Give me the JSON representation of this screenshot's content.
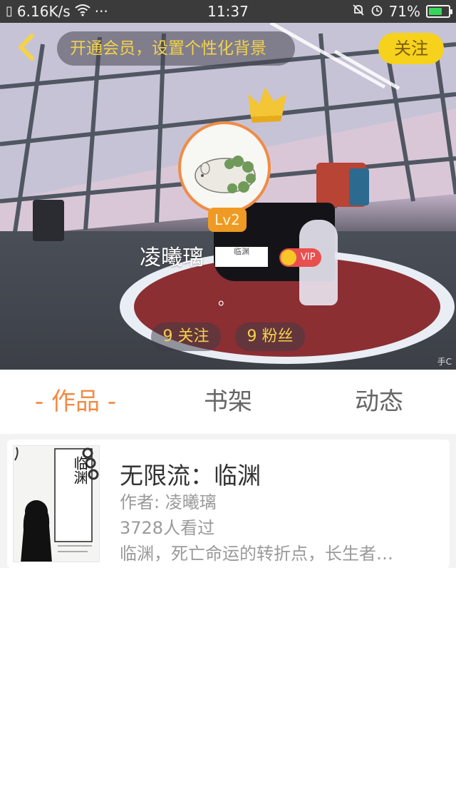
{
  "status_bar": {
    "network_speed": "6.16K/s",
    "dots": "···",
    "time": "11:37",
    "battery": "71%",
    "battery_level": 0.71
  },
  "header": {
    "back_icon": "chevron-left-icon",
    "vip_prompt": "开通会员，设置个性化背景",
    "follow_label": "关注"
  },
  "profile": {
    "level": "Lv2",
    "username": "凌曦璃",
    "seal_text": "临渊",
    "vip_label": "VIP",
    "signature": "。",
    "following": "9 关注",
    "followers": "9 粉丝"
  },
  "tabs": [
    {
      "label": "- 作品 -",
      "active": true
    },
    {
      "label": "书架",
      "active": false
    },
    {
      "label": "动态",
      "active": false
    }
  ],
  "books": [
    {
      "title": "无限流：临渊",
      "author": "作者: 凌曦璃",
      "views": "3728人看过",
      "description": "临渊，死亡命运的转折点，长生者…",
      "cover_title": "临渊"
    }
  ],
  "colors": {
    "accent_yellow": "#f6d21c",
    "accent_orange": "#f08c45",
    "vip_red": "#e94f4f"
  }
}
